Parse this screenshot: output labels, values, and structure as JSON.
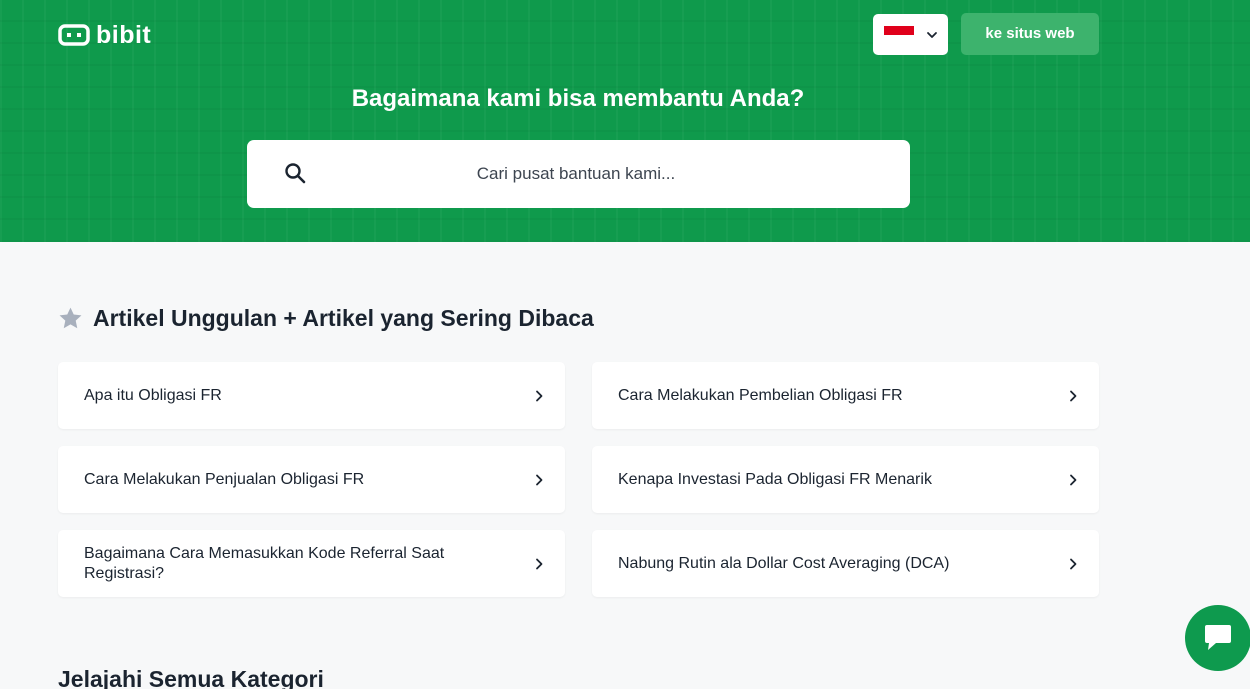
{
  "header": {
    "logo_text": "bibit",
    "language_flag": "indonesia-flag",
    "site_button_label": "ke situs web",
    "title": "Bagaimana kami bisa membantu Anda?",
    "search_placeholder": "Cari pusat bantuan kami..."
  },
  "featured": {
    "icon": "star-icon",
    "title": "Artikel Unggulan + Artikel yang Sering Dibaca",
    "articles": [
      {
        "label": "Apa itu Obligasi FR"
      },
      {
        "label": "Cara Melakukan Pembelian Obligasi FR"
      },
      {
        "label": "Cara Melakukan Penjualan Obligasi FR"
      },
      {
        "label": "Kenapa Investasi Pada Obligasi FR Menarik"
      },
      {
        "label": "Bagaimana Cara Memasukkan Kode Referral Saat Registrasi?"
      },
      {
        "label": "Nabung Rutin ala Dollar Cost Averaging (DCA)"
      }
    ]
  },
  "categories": {
    "title": "Jelajahi Semua Kategori"
  },
  "chat": {
    "icon": "chat-icon"
  },
  "colors": {
    "brand_green": "#0f9a4c",
    "button_green": "#3db36d",
    "page_bg": "#f7f8f9",
    "text_dark": "#1b2430"
  }
}
